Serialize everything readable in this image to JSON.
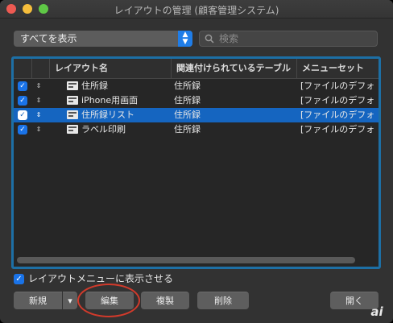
{
  "window": {
    "title": "レイアウトの管理 (顧客管理システム)"
  },
  "filter": {
    "selected": "すべてを表示",
    "stepper_glyph": "⌃⌄"
  },
  "search": {
    "placeholder": "検索"
  },
  "table": {
    "columns": [
      "レイアウト名",
      "関連付けられているテーブル",
      "メニューセット"
    ],
    "rows": [
      {
        "checked": true,
        "name": "住所録",
        "table": "住所録",
        "menu": "[ファイルのデフォ",
        "selected": false
      },
      {
        "checked": true,
        "name": "iPhone用画面",
        "table": "住所録",
        "menu": "[ファイルのデフォ",
        "selected": false
      },
      {
        "checked": true,
        "name": "住所録リスト",
        "table": "住所録",
        "menu": "[ファイルのデフォ",
        "selected": true
      },
      {
        "checked": true,
        "name": "ラベル印刷",
        "table": "住所録",
        "menu": "[ファイルのデフォ",
        "selected": false
      }
    ]
  },
  "options": {
    "show_in_menu_label": "レイアウトメニューに表示させる",
    "show_in_menu_checked": true
  },
  "buttons": {
    "new": "新規",
    "dropdown": "▾",
    "edit": "編集",
    "duplicate": "複製",
    "delete": "削除",
    "open": "開く"
  },
  "glyphs": {
    "check": "✓",
    "reorder": "⇕"
  },
  "watermark": {
    "text": "ai"
  },
  "colors": {
    "accent": "#1a73e8",
    "selection": "#1565c0",
    "focus_ring": "#1d6fa5",
    "annotation_oval": "#d13a2b"
  }
}
